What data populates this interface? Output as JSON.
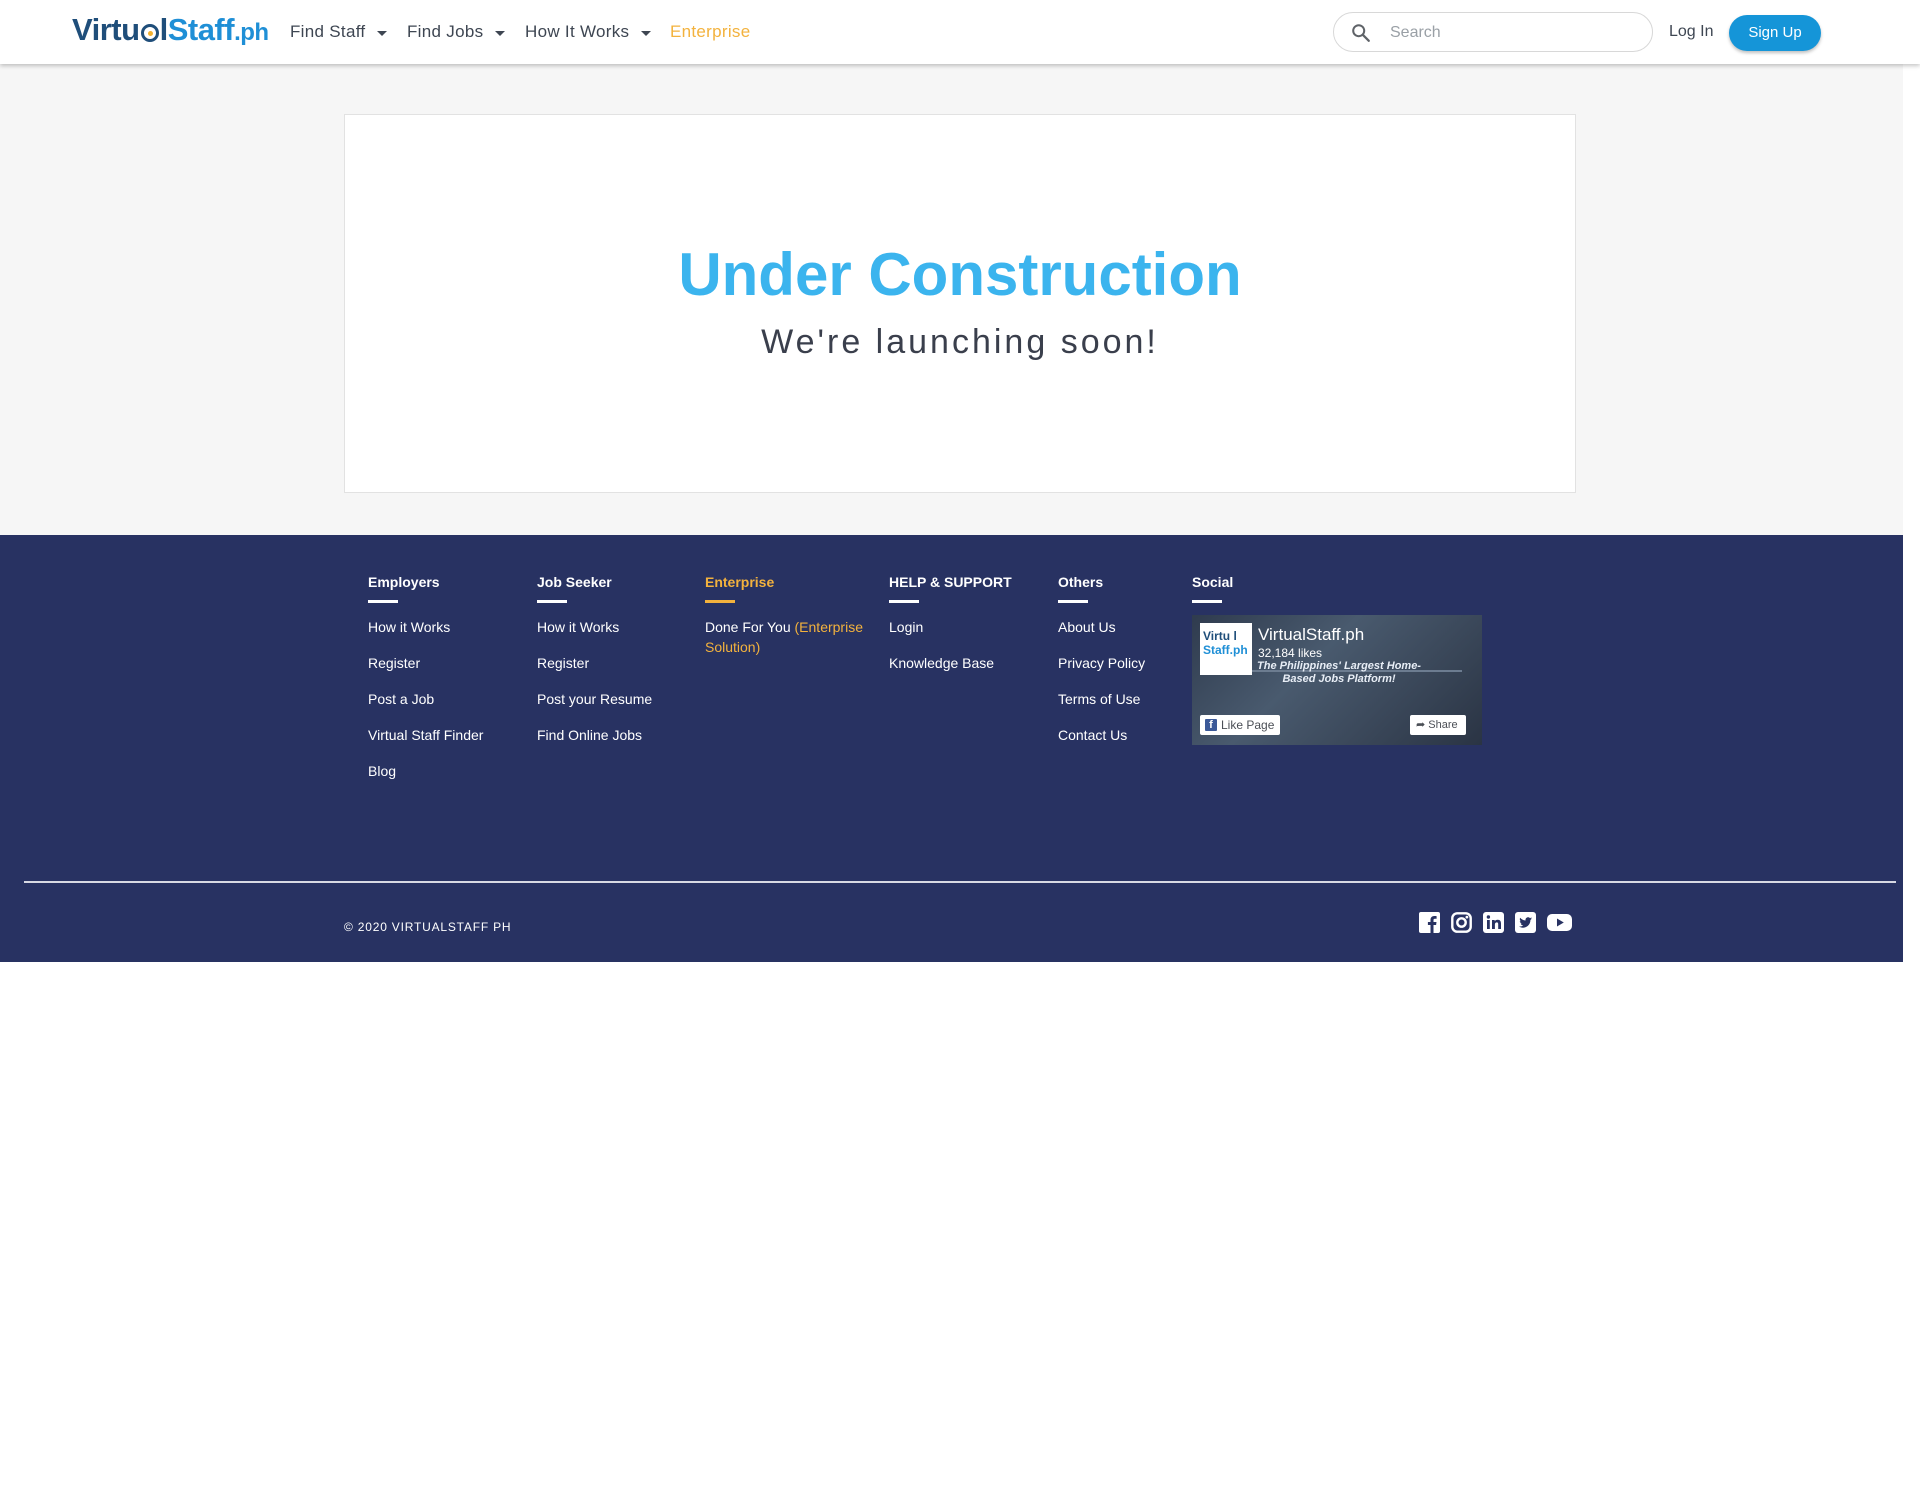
{
  "header": {
    "logo": {
      "part1": "Virtu",
      "part2": "l",
      "part3": "Staff",
      "part4": ".ph"
    },
    "nav": [
      {
        "label": "Find Staff",
        "dropdown": true
      },
      {
        "label": "Find Jobs",
        "dropdown": true
      },
      {
        "label": "How It Works",
        "dropdown": true
      },
      {
        "label": "Enterprise",
        "dropdown": false
      }
    ],
    "search": {
      "placeholder": "Search",
      "value": ""
    },
    "login_label": "Log In",
    "signup_label": "Sign Up"
  },
  "main": {
    "title": "Under Construction",
    "subtitle": "We're launching soon!"
  },
  "footer": {
    "columns": [
      {
        "heading": "Employers",
        "items": [
          "How it Works",
          "Register",
          "Post a Job",
          "Virtual Staff Finder",
          "Blog"
        ]
      },
      {
        "heading": "Job Seeker",
        "items": [
          "How it Works",
          "Register",
          "Post your Resume",
          "Find Online Jobs"
        ]
      },
      {
        "heading": "Enterprise",
        "items": [
          {
            "text": "Done For You",
            "highlight": "(Enterprise Solution)"
          }
        ]
      },
      {
        "heading": "HELP & SUPPORT",
        "items": [
          "Login",
          "Knowledge Base"
        ]
      },
      {
        "heading": "Others",
        "items": [
          "About Us",
          "Privacy Policy",
          "Terms of Use",
          "Contact Us"
        ]
      },
      {
        "heading": "Social",
        "items": []
      }
    ],
    "fb_widget": {
      "page_name": "VirtualStaff.ph",
      "likes": "32,184 likes",
      "tagline": "The Philippines' Largest Home-Based Jobs Platform!",
      "like_label": "Like Page",
      "share_label": "Share",
      "logo_top": "Virtu l",
      "logo_bottom": "Staff.ph"
    },
    "copyright": "© 2020 VIRTUALSTAFF PH",
    "social_icons": [
      "facebook-icon",
      "instagram-icon",
      "linkedin-icon",
      "twitter-icon",
      "youtube-icon"
    ]
  },
  "colors": {
    "accent_blue": "#3bb4ee",
    "signup_blue": "#1595d8",
    "enterprise_orange": "#f3b23d",
    "footer_navy": "#283262"
  }
}
